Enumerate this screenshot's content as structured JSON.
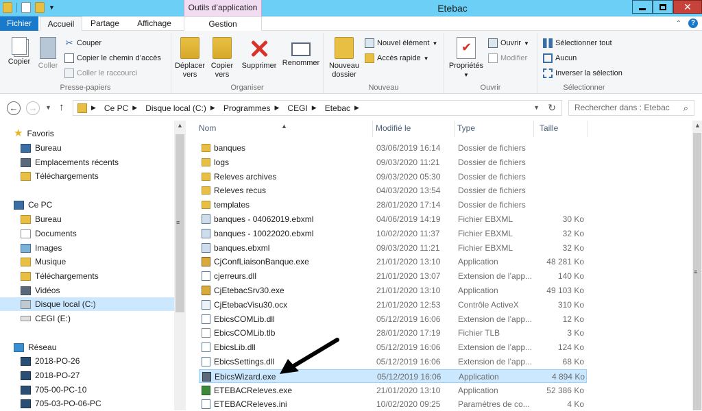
{
  "window": {
    "title": "Etebac",
    "contextual_tab": "Outils d’application"
  },
  "ribbon_tabs": {
    "file": "Fichier",
    "home": "Accueil",
    "share": "Partage",
    "view": "Affichage",
    "manage": "Gestion"
  },
  "ribbon": {
    "clipboard": {
      "copy": "Copier",
      "paste": "Coller",
      "cut": "Couper",
      "copy_path": "Copier le chemin d’accès",
      "paste_shortcut": "Coller le raccourci",
      "label": "Presse-papiers"
    },
    "organize": {
      "move_to_line1": "Déplacer",
      "move_to_line2": "vers",
      "copy_to_line1": "Copier",
      "copy_to_line2": "vers",
      "delete": "Supprimer",
      "rename": "Renommer",
      "label": "Organiser"
    },
    "new": {
      "new_folder_line1": "Nouveau",
      "new_folder_line2": "dossier",
      "new_item": "Nouvel élément",
      "easy_access": "Accès rapide",
      "label": "Nouveau"
    },
    "open": {
      "properties": "Propriétés",
      "open": "Ouvrir",
      "modify": "Modifier",
      "label": "Ouvrir"
    },
    "select": {
      "select_all": "Sélectionner tout",
      "select_none": "Aucun",
      "invert": "Inverser la sélection",
      "label": "Sélectionner"
    }
  },
  "address": {
    "crumbs": [
      "Ce PC",
      "Disque local (C:)",
      "Programmes",
      "CEGI",
      "Etebac"
    ],
    "search_placeholder": "Rechercher dans : Etebac"
  },
  "nav": {
    "favorites": "Favoris",
    "fav_items": [
      "Bureau",
      "Emplacements récents",
      "Téléchargements"
    ],
    "this_pc": "Ce PC",
    "pc_items": [
      "Bureau",
      "Documents",
      "Images",
      "Musique",
      "Téléchargements",
      "Vidéos",
      "Disque local (C:)",
      "CEGI (E:)"
    ],
    "network": "Réseau",
    "net_items": [
      "2018-PO-26",
      "2018-PO-27",
      "705-00-PC-10",
      "705-03-PO-06-PC"
    ]
  },
  "columns": {
    "name": "Nom",
    "modified": "Modifié le",
    "type": "Type",
    "size": "Taille"
  },
  "files": [
    {
      "name": "banques",
      "date": "03/06/2019 16:14",
      "type": "Dossier de fichiers",
      "size": "",
      "icon": "folder-icon"
    },
    {
      "name": "logs",
      "date": "09/03/2020 11:21",
      "type": "Dossier de fichiers",
      "size": "",
      "icon": "folder-icon"
    },
    {
      "name": "Releves archives",
      "date": "09/03/2020 05:30",
      "type": "Dossier de fichiers",
      "size": "",
      "icon": "folder-icon"
    },
    {
      "name": "Releves recus",
      "date": "04/03/2020 13:54",
      "type": "Dossier de fichiers",
      "size": "",
      "icon": "folder-icon"
    },
    {
      "name": "templates",
      "date": "28/01/2020 17:14",
      "type": "Dossier de fichiers",
      "size": "",
      "icon": "folder-icon"
    },
    {
      "name": "banques - 04062019.ebxml",
      "date": "04/06/2019 14:19",
      "type": "Fichier EBXML",
      "size": "30 Ko",
      "icon": "xml-file-icon"
    },
    {
      "name": "banques - 10022020.ebxml",
      "date": "10/02/2020 11:37",
      "type": "Fichier EBXML",
      "size": "32 Ko",
      "icon": "xml-file-icon"
    },
    {
      "name": "banques.ebxml",
      "date": "09/03/2020 11:21",
      "type": "Fichier EBXML",
      "size": "32 Ko",
      "icon": "xml-file-icon"
    },
    {
      "name": "CjConfLiaisonBanque.exe",
      "date": "21/01/2020 13:10",
      "type": "Application",
      "size": "48 281 Ko",
      "icon": "exe-icon"
    },
    {
      "name": "cjerreurs.dll",
      "date": "21/01/2020 13:07",
      "type": "Extension de l’app...",
      "size": "140 Ko",
      "icon": "dll-icon"
    },
    {
      "name": "CjEtebacSrv30.exe",
      "date": "21/01/2020 13:10",
      "type": "Application",
      "size": "49 103 Ko",
      "icon": "exe-icon"
    },
    {
      "name": "CjEtebacVisu30.ocx",
      "date": "21/01/2020 12:53",
      "type": "Contrôle ActiveX",
      "size": "310 Ko",
      "icon": "ocx-icon"
    },
    {
      "name": "EbicsCOMLib.dll",
      "date": "05/12/2019 16:06",
      "type": "Extension de l’app...",
      "size": "12 Ko",
      "icon": "dll-icon"
    },
    {
      "name": "EbicsCOMLib.tlb",
      "date": "28/01/2020 17:19",
      "type": "Fichier TLB",
      "size": "3 Ko",
      "icon": "tlb-icon"
    },
    {
      "name": "EbicsLib.dll",
      "date": "05/12/2019 16:06",
      "type": "Extension de l’app...",
      "size": "124 Ko",
      "icon": "dll-icon"
    },
    {
      "name": "EbicsSettings.dll",
      "date": "05/12/2019 16:06",
      "type": "Extension de l’app...",
      "size": "68 Ko",
      "icon": "dll-icon"
    },
    {
      "name": "EbicsWizard.exe",
      "date": "05/12/2019 16:06",
      "type": "Application",
      "size": "4 894 Ko",
      "icon": "wizard-exe-icon",
      "selected": true
    },
    {
      "name": "ETEBACReleves.exe",
      "date": "21/01/2020 13:10",
      "type": "Application",
      "size": "52 386 Ko",
      "icon": "releves-exe-icon"
    },
    {
      "name": "ETEBACReleves.ini",
      "date": "10/02/2020 09:25",
      "type": "Paramètres de co...",
      "size": "4 Ko",
      "icon": "ini-file-icon"
    }
  ]
}
